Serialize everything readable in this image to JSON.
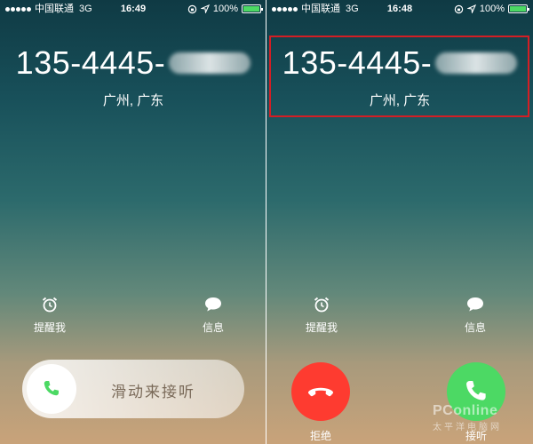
{
  "left_screen": {
    "status": {
      "carrier": "中国联通",
      "network": "3G",
      "time": "16:49",
      "battery": "100%"
    },
    "caller": {
      "number": "135-4445-",
      "location": "广州, 广东"
    },
    "options": {
      "remind": "提醒我",
      "message": "信息"
    },
    "slider": {
      "label": "滑动来接听"
    }
  },
  "right_screen": {
    "status": {
      "carrier": "中国联通",
      "network": "3G",
      "time": "16:48",
      "battery": "100%"
    },
    "caller": {
      "number": "135-4445-",
      "location": "广州, 广东"
    },
    "options": {
      "remind": "提醒我",
      "message": "信息"
    },
    "buttons": {
      "decline": "拒绝",
      "accept": "接听"
    }
  },
  "colors": {
    "decline": "#fe3b30",
    "accept": "#4cd964",
    "highlight": "#d41e24"
  },
  "icons": {
    "remind": "alarm-clock-icon",
    "message": "speech-bubble-icon",
    "phone": "phone-handset-icon"
  },
  "watermark": {
    "brand": "PConline",
    "sub": "太平洋电脑网"
  }
}
